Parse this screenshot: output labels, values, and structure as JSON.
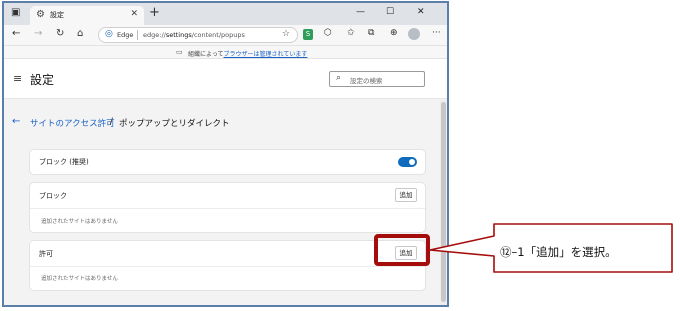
{
  "browser": {
    "tab_title": "設定",
    "tab_close": "✕",
    "new_tab": "+",
    "window_controls": [
      "—",
      "☐",
      "✕"
    ],
    "edge_label": "Edge",
    "url_prefix": "edge://",
    "url_host": "settings",
    "url_path": "/content/popups",
    "ext_letter": "S",
    "more_menu": "···",
    "managed_text": "組織によって",
    "managed_link": "ブラウザーは管理されています"
  },
  "settings": {
    "title": "設定",
    "search_placeholder": "設定の検索"
  },
  "breadcrumb": {
    "parent": "サイトのアクセス許可",
    "separator": "/",
    "current": "ポップアップとリダイレクト"
  },
  "sections": {
    "block_recommended": {
      "label": "ブロック (推奨)",
      "enabled": true
    },
    "block": {
      "label": "ブロック",
      "add_label": "追加",
      "empty_text": "追加されたサイトはありません"
    },
    "allow": {
      "label": "許可",
      "add_label": "追加",
      "empty_text": "追加されたサイトはありません"
    }
  },
  "annotation": {
    "text": "⑫–1「追加」を選択。",
    "color": "#a50d0d"
  }
}
